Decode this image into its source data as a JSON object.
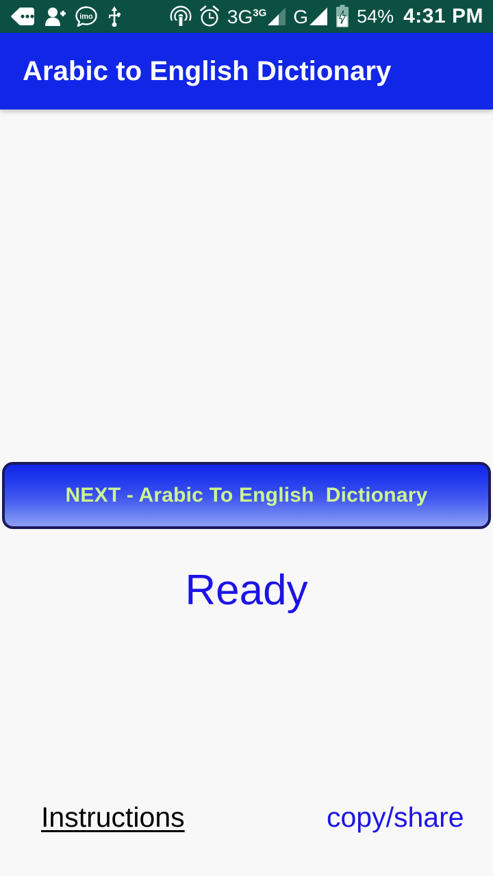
{
  "status_bar": {
    "background_color": "#0c5044",
    "icons": [
      {
        "name": "messages-icon",
        "label": "Messages"
      },
      {
        "name": "add-contact-icon",
        "label": "Add contact"
      },
      {
        "name": "imo-icon",
        "label": "imo"
      },
      {
        "name": "usb-icon",
        "label": "USB"
      },
      {
        "name": "hotspot-icon",
        "label": "Portable hotspot"
      },
      {
        "name": "alarm-icon",
        "label": "Alarm"
      }
    ],
    "imo_label": "imo",
    "network_1_label": "3G",
    "network_1_sup": "3G",
    "network_2_label": "G",
    "battery_percent": "54%",
    "time": "4:31 PM"
  },
  "app_bar": {
    "title": "Arabic to English Dictionary",
    "background_color": "#1226e8",
    "text_color": "#ffffff"
  },
  "main": {
    "next_button_label": "NEXT - Arabic To English  Dictionary",
    "next_button_text_color": "#cdf590",
    "next_button_border_color": "#1a1a5c",
    "status_text": "Ready",
    "status_text_color": "#1c14e4"
  },
  "footer": {
    "instructions_label": "Instructions",
    "instructions_color": "#000000",
    "copy_share_label": "copy/share",
    "copy_share_color": "#1c14e4"
  }
}
